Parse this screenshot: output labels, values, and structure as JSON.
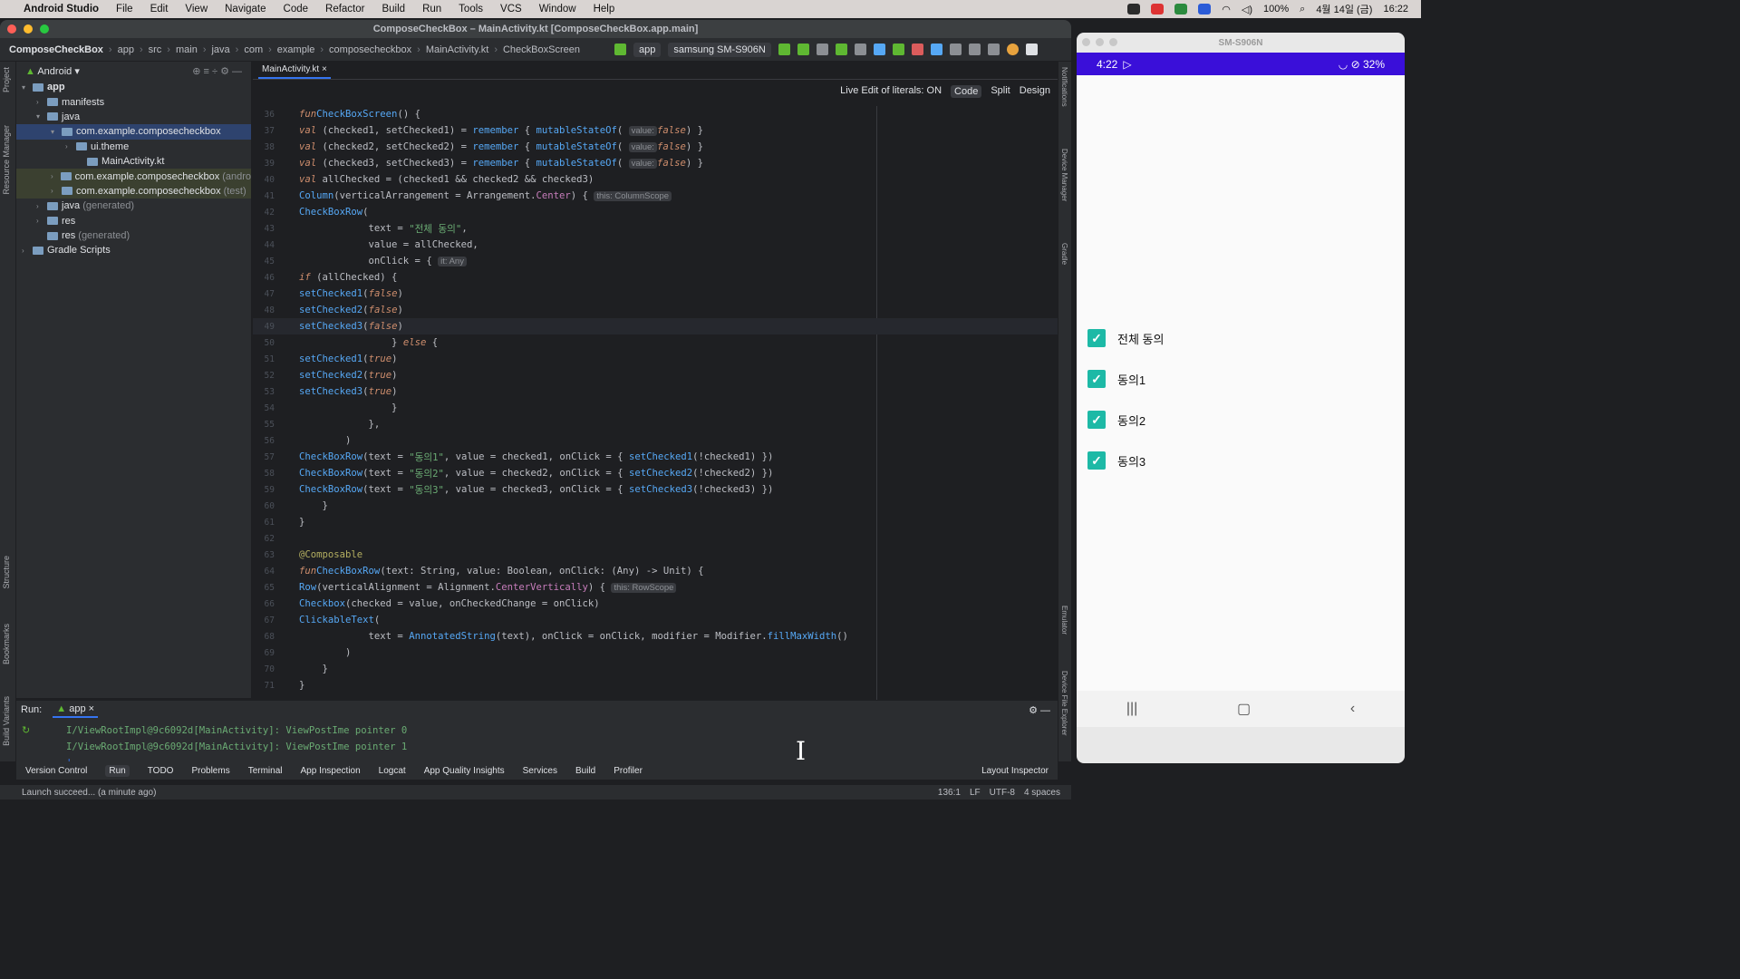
{
  "menubar": {
    "app": "Android Studio",
    "items": [
      "File",
      "Edit",
      "View",
      "Navigate",
      "Code",
      "Refactor",
      "Build",
      "Run",
      "Tools",
      "VCS",
      "Window",
      "Help"
    ],
    "battery": "100%",
    "date": "4월 14일 (금)",
    "time": "16:22"
  },
  "window": {
    "title": "ComposeCheckBox – MainActivity.kt [ComposeCheckBox.app.main]"
  },
  "nav": {
    "crumbs": [
      "ComposeCheckBox",
      "app",
      "src",
      "main",
      "java",
      "com",
      "example",
      "composecheckbox",
      "MainActivity.kt",
      "CheckBoxScreen"
    ],
    "config": "app",
    "device": "samsung SM-S906N"
  },
  "project": {
    "view": "Android",
    "tree": [
      {
        "label": "app",
        "bold": true
      },
      {
        "label": "manifests"
      },
      {
        "label": "java"
      },
      {
        "label": "com.example.composecheckbox"
      },
      {
        "label": "ui.theme"
      },
      {
        "label": "MainActivity.kt"
      },
      {
        "label": "com.example.composecheckbox",
        "suffix": "(andro"
      },
      {
        "label": "com.example.composecheckbox",
        "suffix": "(test)"
      },
      {
        "label": "java",
        "suffix": "(generated)"
      },
      {
        "label": "res"
      },
      {
        "label": "res",
        "suffix": "(generated)"
      },
      {
        "label": "Gradle Scripts"
      }
    ]
  },
  "editor": {
    "tab": "MainActivity.kt",
    "live_edit": "Live Edit of literals: ON",
    "modes": [
      "Code",
      "Split",
      "Design"
    ]
  },
  "code": {
    "start": 36,
    "current": 49
  },
  "run": {
    "label": "Run:",
    "tab": "app",
    "log": [
      "I/ViewRootImpl@9c6092d[MainActivity]: ViewPostIme pointer 0",
      "I/ViewRootImpl@9c6092d[MainActivity]: ViewPostIme pointer 1"
    ]
  },
  "bottom": [
    "Version Control",
    "Run",
    "TODO",
    "Problems",
    "Terminal",
    "App Inspection",
    "Logcat",
    "App Quality Insights",
    "Services",
    "Build",
    "Profiler",
    "Layout Inspector"
  ],
  "status": {
    "msg": "Launch succeed... (a minute ago)",
    "pos": "136:1",
    "lf": "LF",
    "enc": "UTF-8",
    "indent": "4 spaces"
  },
  "left_strip": [
    "Project",
    "Resource Manager",
    "Structure",
    "Bookmarks",
    "Build Variants"
  ],
  "right_strip": [
    "Notifications",
    "Device Manager",
    "Gradle",
    "Emulator",
    "Device File Explorer"
  ],
  "emulator": {
    "title": "SM-S906N",
    "time": "4:22",
    "battery": "32%",
    "checks": [
      "전체 동의",
      "동의1",
      "동의2",
      "동의3"
    ]
  }
}
